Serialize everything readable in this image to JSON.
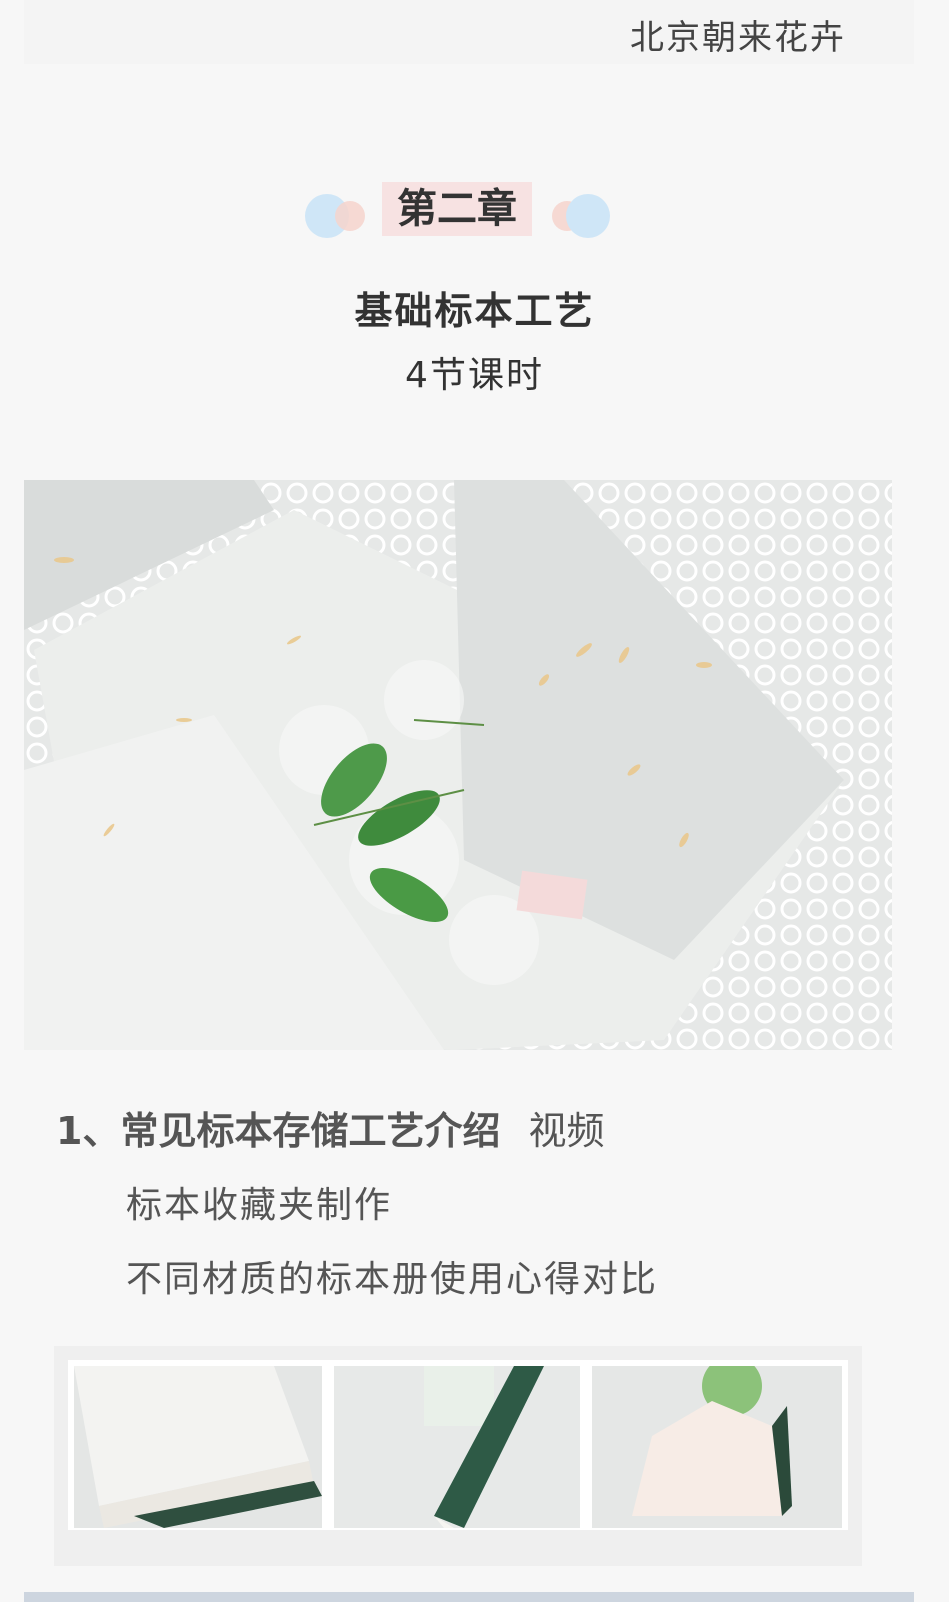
{
  "header": {
    "brand": "北京朝来花卉"
  },
  "chapter": {
    "label": "第二章"
  },
  "section": {
    "title": "基础标本工艺",
    "subtitle": "4节课时"
  },
  "lesson": {
    "number_title": "1、常见标本存储工艺介绍",
    "tag": "视频",
    "items": [
      "标本收藏夹制作",
      "不同材质的标本册使用心得对比"
    ]
  },
  "colors": {
    "chapter_bg": "#f7e2e2",
    "dot_blue": "#cfe6f7",
    "dot_pink": "#f6d3cc"
  },
  "icons": [
    "decorative-dots-icon"
  ]
}
